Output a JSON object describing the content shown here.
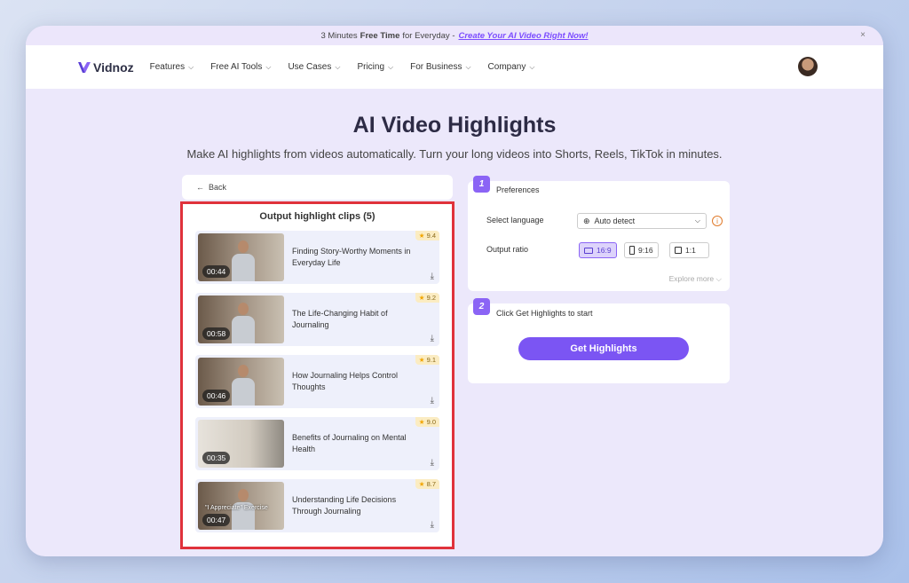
{
  "promo": {
    "prefix": "3 Minutes",
    "bold": "Free Time",
    "suffix": "for Everyday -",
    "link": "Create Your AI Video Right Now!",
    "close": "×"
  },
  "nav": {
    "brand": "Vidnoz",
    "items": [
      {
        "label": "Features"
      },
      {
        "label": "Free AI Tools"
      },
      {
        "label": "Use Cases"
      },
      {
        "label": "Pricing"
      },
      {
        "label": "For Business"
      },
      {
        "label": "Company"
      }
    ]
  },
  "hero": {
    "title": "AI Video Highlights",
    "subtitle": "Make AI highlights from videos automatically. Turn your long videos into Shorts, Reels, TikTok in minutes."
  },
  "left": {
    "back": "Back",
    "clips_title": "Output highlight clips (5)",
    "clips": [
      {
        "title": "Finding Story-Worthy Moments in Everyday Life",
        "duration": "00:44",
        "score": "9.4"
      },
      {
        "title": "The Life-Changing Habit of Journaling",
        "duration": "00:58",
        "score": "9.2"
      },
      {
        "title": "How Journaling Helps Control Thoughts",
        "duration": "00:46",
        "score": "9.1"
      },
      {
        "title": "Benefits of Journaling on Mental Health",
        "duration": "00:35",
        "score": "9.0"
      },
      {
        "title": "Understanding Life Decisions Through Journaling",
        "duration": "00:47",
        "score": "8.7",
        "caption": "\"I Appreciate\" Exercise"
      }
    ]
  },
  "step1": {
    "num": "1",
    "label": "Preferences",
    "language_label": "Select language",
    "language_value": "Auto detect",
    "ratio_label": "Output ratio",
    "ratios": [
      "16:9",
      "9:16",
      "1:1"
    ],
    "explore": "Explore more"
  },
  "step2": {
    "num": "2",
    "label": "Click Get Highlights to start",
    "button": "Get Highlights"
  },
  "colors": {
    "accent": "#7b55f3",
    "highlight_border": "#e0323b"
  }
}
